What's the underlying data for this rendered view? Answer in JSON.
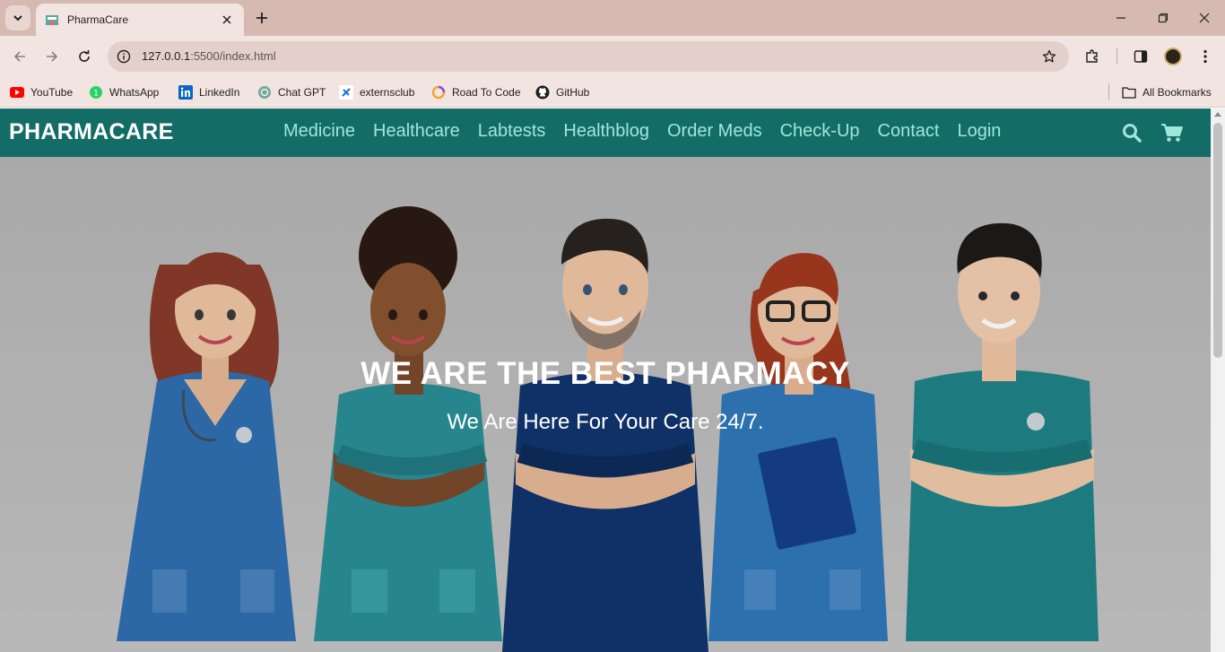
{
  "browser": {
    "tab_title": "PharmaCare",
    "url_host": "127.0.0.1",
    "url_path": ":5500/index.html",
    "bookmarks": [
      {
        "label": "YouTube",
        "icon": "youtube-icon"
      },
      {
        "label": "WhatsApp",
        "icon": "whatsapp-icon"
      },
      {
        "label": "LinkedIn",
        "icon": "linkedin-icon"
      },
      {
        "label": "Chat GPT",
        "icon": "chatgpt-icon"
      },
      {
        "label": "externsclub",
        "icon": "externsclub-icon"
      },
      {
        "label": "Road To Code",
        "icon": "roadtocode-icon"
      },
      {
        "label": "GitHub",
        "icon": "github-icon"
      }
    ],
    "all_bookmarks": "All Bookmarks"
  },
  "site": {
    "logo": "PHARMACARE",
    "nav": [
      "Medicine",
      "Healthcare",
      "Labtests",
      "Healthblog",
      "Order Meds",
      "Check-Up",
      "Contact",
      "Login"
    ],
    "hero_title": "WE ARE THE BEST PHARMACY",
    "hero_subtitle": "We Are Here For Your Care 24/7."
  },
  "colors": {
    "header_bg": "#146c66",
    "nav_link": "#9fe6dd",
    "chrome_tabstrip": "#d6bab2",
    "chrome_toolbar": "#f2e4e0"
  }
}
